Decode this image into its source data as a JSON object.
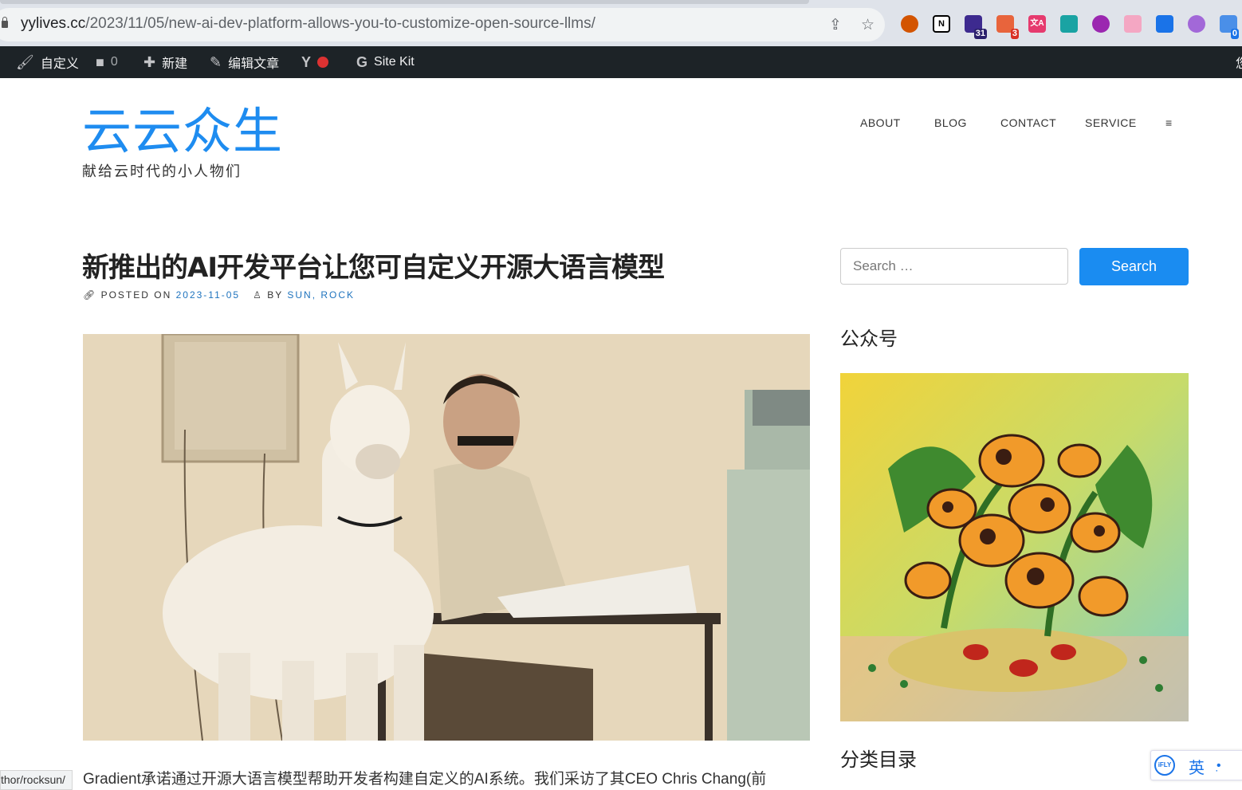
{
  "browser": {
    "url_host": "yylives.cc",
    "url_path": "/2023/11/05/new-ai-dev-platform-allows-you-to-customize-open-source-llms/",
    "extensions": [
      {
        "name": "chrome-ext-1"
      },
      {
        "name": "notion-icon",
        "label": "N"
      },
      {
        "name": "grad-cap-icon",
        "badge": "31"
      },
      {
        "name": "ext-red-icon",
        "badge": "3"
      },
      {
        "name": "translate-icon",
        "label": "文A"
      },
      {
        "name": "ext-network-icon"
      },
      {
        "name": "ext-purple-icon"
      },
      {
        "name": "ext-basket-icon"
      },
      {
        "name": "ext-blue-icon"
      },
      {
        "name": "openai-icon"
      },
      {
        "name": "ext-sync-icon",
        "badge": "0"
      }
    ],
    "status_url": "thor/rocksun/"
  },
  "admin_bar": {
    "customize": "自定义",
    "comments": "0",
    "new": "新建",
    "edit_post": "编辑文章",
    "site_kit": "Site Kit",
    "right_cut": "您"
  },
  "site": {
    "title": "云云众生",
    "tagline": "献给云时代的小人物们",
    "nav": [
      "ABOUT",
      "BLOG",
      "CONTACT",
      "SERVICE",
      "≡"
    ]
  },
  "post": {
    "title": "新推出的AI开发平台让您可自定义开源大语言模型",
    "posted_on_label": "POSTED ON",
    "date": "2023-11-05",
    "by_label": "BY",
    "author": "SUN, ROCK",
    "excerpt": "Gradient承诺通过开源大语言模型帮助开发者构建自定义的AI系统。我们采访了其CEO Chris Chang(前"
  },
  "sidebar": {
    "search_placeholder": "Search …",
    "search_button": "Search",
    "widget1_title": "公众号",
    "widget2_title": "分类目录"
  },
  "ime": {
    "lang": "英",
    "logo": "iFLY"
  }
}
